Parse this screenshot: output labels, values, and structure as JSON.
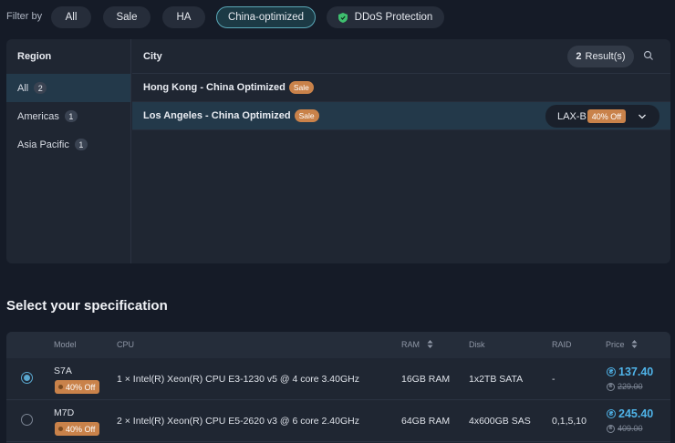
{
  "filter": {
    "label": "Filter by",
    "chips": [
      {
        "label": "All"
      },
      {
        "label": "Sale"
      },
      {
        "label": "HA"
      },
      {
        "label": "China-optimized",
        "active": true
      },
      {
        "label": "DDoS Protection",
        "icon": "shield-icon"
      }
    ]
  },
  "region": {
    "header": "Region",
    "items": [
      {
        "label": "All",
        "count": "2",
        "active": true
      },
      {
        "label": "Americas",
        "count": "1"
      },
      {
        "label": "Asia Pacific",
        "count": "1"
      }
    ]
  },
  "city": {
    "header": "City",
    "results_count": "2",
    "results_label": "Result(s)",
    "rows": [
      {
        "name": "Hong Kong - China Optimized",
        "badge": "Sale"
      },
      {
        "name": "Los Angeles - China Optimized",
        "badge": "Sale",
        "active": true,
        "datacenter": "LAX-B",
        "discount": "40% Off"
      }
    ]
  },
  "spec": {
    "title": "Select your specification",
    "columns": {
      "model": "Model",
      "cpu": "CPU",
      "ram": "RAM",
      "disk": "Disk",
      "raid": "RAID",
      "price": "Price"
    },
    "rows": [
      {
        "model": "S7A",
        "discount": "40% Off",
        "cpu": "1 × Intel(R) Xeon(R) CPU E3-1230 v5 @ 4 core 3.40GHz",
        "ram": "16GB RAM",
        "disk": "1x2TB SATA",
        "raid": "-",
        "price": "137.40",
        "old_price": "229.00",
        "selected": true
      },
      {
        "model": "M7D",
        "discount": "40% Off",
        "cpu": "2 × Intel(R) Xeon(R) CPU E5-2620 v3 @ 6 core 2.40GHz",
        "ram": "64GB RAM",
        "disk": "4x600GB SAS",
        "raid": "0,1,5,10",
        "price": "245.40",
        "old_price": "409.00",
        "selected": false
      }
    ]
  },
  "colors": {
    "accent": "#5aa8b8",
    "price": "#4fb3e8",
    "sale": "#c9824a",
    "shield": "#3fbf6f"
  }
}
